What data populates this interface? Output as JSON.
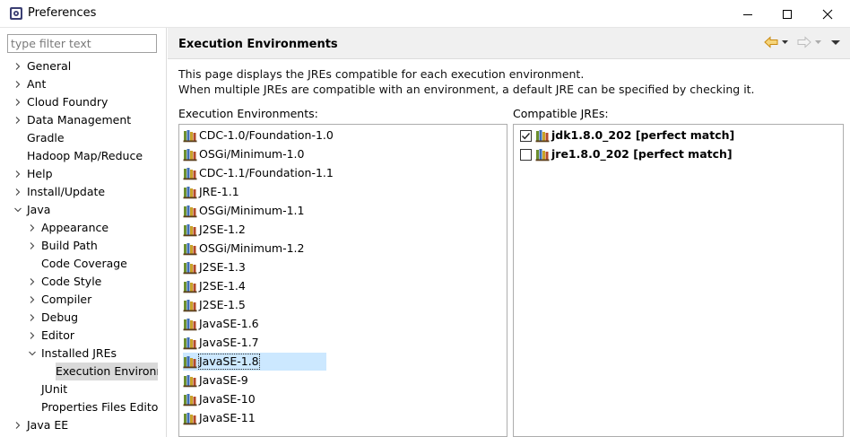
{
  "window": {
    "title": "Preferences"
  },
  "filter": {
    "placeholder": "type filter text"
  },
  "tree": [
    {
      "label": "General",
      "level": 0,
      "twisty": "right"
    },
    {
      "label": "Ant",
      "level": 0,
      "twisty": "right"
    },
    {
      "label": "Cloud Foundry",
      "level": 0,
      "twisty": "right"
    },
    {
      "label": "Data Management",
      "level": 0,
      "twisty": "right"
    },
    {
      "label": "Gradle",
      "level": 0,
      "twisty": "none"
    },
    {
      "label": "Hadoop Map/Reduce",
      "level": 0,
      "twisty": "none"
    },
    {
      "label": "Help",
      "level": 0,
      "twisty": "right"
    },
    {
      "label": "Install/Update",
      "level": 0,
      "twisty": "right"
    },
    {
      "label": "Java",
      "level": 0,
      "twisty": "down"
    },
    {
      "label": "Appearance",
      "level": 1,
      "twisty": "right"
    },
    {
      "label": "Build Path",
      "level": 1,
      "twisty": "right"
    },
    {
      "label": "Code Coverage",
      "level": 1,
      "twisty": "none"
    },
    {
      "label": "Code Style",
      "level": 1,
      "twisty": "right"
    },
    {
      "label": "Compiler",
      "level": 1,
      "twisty": "right"
    },
    {
      "label": "Debug",
      "level": 1,
      "twisty": "right"
    },
    {
      "label": "Editor",
      "level": 1,
      "twisty": "right"
    },
    {
      "label": "Installed JREs",
      "level": 1,
      "twisty": "down"
    },
    {
      "label": "Execution Environm",
      "level": 2,
      "twisty": "none",
      "selected": true
    },
    {
      "label": "JUnit",
      "level": 1,
      "twisty": "none"
    },
    {
      "label": "Properties Files Editor",
      "level": 1,
      "twisty": "none"
    },
    {
      "label": "Java EE",
      "level": 0,
      "twisty": "right"
    }
  ],
  "page": {
    "title": "Execution Environments",
    "description_line1": "This page displays the JREs compatible for each execution environment.",
    "description_line2": "When multiple JREs are compatible with an environment, a default JRE can be specified by checking it.",
    "environments_label": "Execution Environments:",
    "jres_label": "Compatible JREs:"
  },
  "environments": [
    "CDC-1.0/Foundation-1.0",
    "OSGi/Minimum-1.0",
    "CDC-1.1/Foundation-1.1",
    "JRE-1.1",
    "OSGi/Minimum-1.1",
    "J2SE-1.2",
    "OSGi/Minimum-1.2",
    "J2SE-1.3",
    "J2SE-1.4",
    "J2SE-1.5",
    "JavaSE-1.6",
    "JavaSE-1.7",
    "JavaSE-1.8",
    "JavaSE-9",
    "JavaSE-10",
    "JavaSE-11"
  ],
  "selected_environment": "JavaSE-1.8",
  "jres": [
    {
      "label": "jdk1.8.0_202 [perfect match]",
      "checked": true
    },
    {
      "label": "jre1.8.0_202 [perfect match]",
      "checked": false
    }
  ],
  "icons": {
    "app": "eclipse-preferences-icon",
    "back": "back-arrow-icon",
    "forward": "forward-arrow-icon",
    "menu": "view-menu-icon",
    "environment": "jar-library-icon"
  },
  "colors": {
    "selection": "#cce8ff",
    "tree_selection": "#d9d9d9",
    "header_bg": "#f0f0f0",
    "back_arrow": "#e8a317"
  }
}
